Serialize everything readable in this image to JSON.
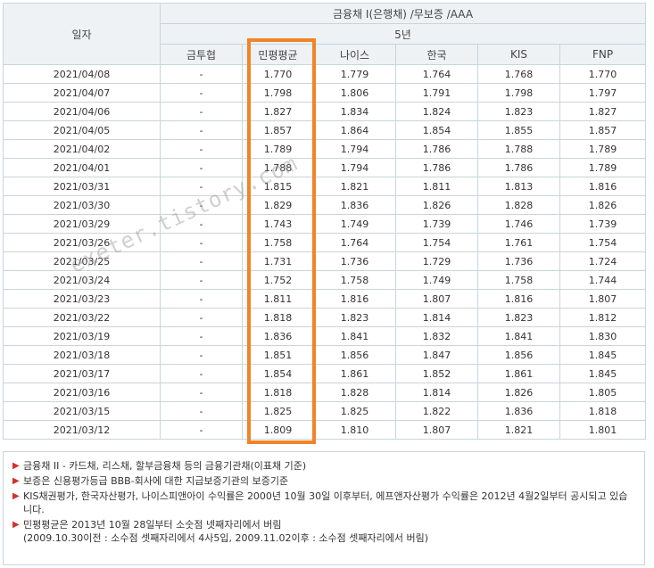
{
  "table": {
    "date_header": "일자",
    "group_header": "금융채 I(은행채) /무보증 /AAA",
    "tenor_header": "5년",
    "columns": [
      "금투협",
      "민평평균",
      "나이스",
      "한국",
      "KIS",
      "FNP"
    ],
    "rows": [
      {
        "date": "2021/04/08",
        "kofia": "-",
        "avg": "1.770",
        "nice": "1.779",
        "korea": "1.764",
        "kis": "1.768",
        "fnp": "1.770"
      },
      {
        "date": "2021/04/07",
        "kofia": "-",
        "avg": "1.798",
        "nice": "1.806",
        "korea": "1.791",
        "kis": "1.798",
        "fnp": "1.797"
      },
      {
        "date": "2021/04/06",
        "kofia": "-",
        "avg": "1.827",
        "nice": "1.834",
        "korea": "1.824",
        "kis": "1.823",
        "fnp": "1.827"
      },
      {
        "date": "2021/04/05",
        "kofia": "-",
        "avg": "1.857",
        "nice": "1.864",
        "korea": "1.854",
        "kis": "1.855",
        "fnp": "1.857"
      },
      {
        "date": "2021/04/02",
        "kofia": "-",
        "avg": "1.789",
        "nice": "1.794",
        "korea": "1.786",
        "kis": "1.788",
        "fnp": "1.789"
      },
      {
        "date": "2021/04/01",
        "kofia": "-",
        "avg": "1.788",
        "nice": "1.794",
        "korea": "1.786",
        "kis": "1.786",
        "fnp": "1.789"
      },
      {
        "date": "2021/03/31",
        "kofia": "-",
        "avg": "1.815",
        "nice": "1.821",
        "korea": "1.811",
        "kis": "1.813",
        "fnp": "1.816"
      },
      {
        "date": "2021/03/30",
        "kofia": "-",
        "avg": "1.829",
        "nice": "1.836",
        "korea": "1.826",
        "kis": "1.828",
        "fnp": "1.826"
      },
      {
        "date": "2021/03/29",
        "kofia": "-",
        "avg": "1.743",
        "nice": "1.749",
        "korea": "1.739",
        "kis": "1.746",
        "fnp": "1.739"
      },
      {
        "date": "2021/03/26",
        "kofia": "-",
        "avg": "1.758",
        "nice": "1.764",
        "korea": "1.754",
        "kis": "1.761",
        "fnp": "1.754"
      },
      {
        "date": "2021/03/25",
        "kofia": "-",
        "avg": "1.731",
        "nice": "1.736",
        "korea": "1.729",
        "kis": "1.736",
        "fnp": "1.724"
      },
      {
        "date": "2021/03/24",
        "kofia": "-",
        "avg": "1.752",
        "nice": "1.758",
        "korea": "1.749",
        "kis": "1.758",
        "fnp": "1.744"
      },
      {
        "date": "2021/03/23",
        "kofia": "-",
        "avg": "1.811",
        "nice": "1.816",
        "korea": "1.807",
        "kis": "1.816",
        "fnp": "1.807"
      },
      {
        "date": "2021/03/22",
        "kofia": "-",
        "avg": "1.818",
        "nice": "1.823",
        "korea": "1.814",
        "kis": "1.823",
        "fnp": "1.812"
      },
      {
        "date": "2021/03/19",
        "kofia": "-",
        "avg": "1.836",
        "nice": "1.841",
        "korea": "1.832",
        "kis": "1.841",
        "fnp": "1.830"
      },
      {
        "date": "2021/03/18",
        "kofia": "-",
        "avg": "1.851",
        "nice": "1.856",
        "korea": "1.847",
        "kis": "1.856",
        "fnp": "1.845"
      },
      {
        "date": "2021/03/17",
        "kofia": "-",
        "avg": "1.854",
        "nice": "1.861",
        "korea": "1.852",
        "kis": "1.861",
        "fnp": "1.845"
      },
      {
        "date": "2021/03/16",
        "kofia": "-",
        "avg": "1.818",
        "nice": "1.828",
        "korea": "1.814",
        "kis": "1.826",
        "fnp": "1.805"
      },
      {
        "date": "2021/03/15",
        "kofia": "-",
        "avg": "1.825",
        "nice": "1.825",
        "korea": "1.822",
        "kis": "1.836",
        "fnp": "1.818"
      },
      {
        "date": "2021/03/12",
        "kofia": "-",
        "avg": "1.809",
        "nice": "1.810",
        "korea": "1.807",
        "kis": "1.821",
        "fnp": "1.801"
      }
    ]
  },
  "watermark": "exeter.tistory.com",
  "notes": [
    {
      "text": "금융채 II - 카드채, 리스채, 할부금융채 등의 금융기관채(이표채 기준)"
    },
    {
      "text": "보증은 신용평가등급 BBB-회사에 대한 지급보증기관의 보증기준"
    },
    {
      "text": "KIS채권평가, 한국자산평가, 나이스피앤아이 수익률은 2000년 10월 30일 이후부터, 에프앤자산평가 수익률은 2012년 4월2일부터 공시되고 있습니다."
    },
    {
      "text": "민평평균은 2013년 10월 28일부터 소숫점 넷째자리에서 버림",
      "sub": "(2009.10.30이전 : 소수점 셋째자리에서 4사5입, 2009.11.02이후 : 소수점 셋째자리에서 버림)"
    }
  ],
  "colors": {
    "highlight": "#f08427",
    "bullet": "#d0312d",
    "header_bg": "#eef2f5",
    "border": "#c7d5de"
  }
}
